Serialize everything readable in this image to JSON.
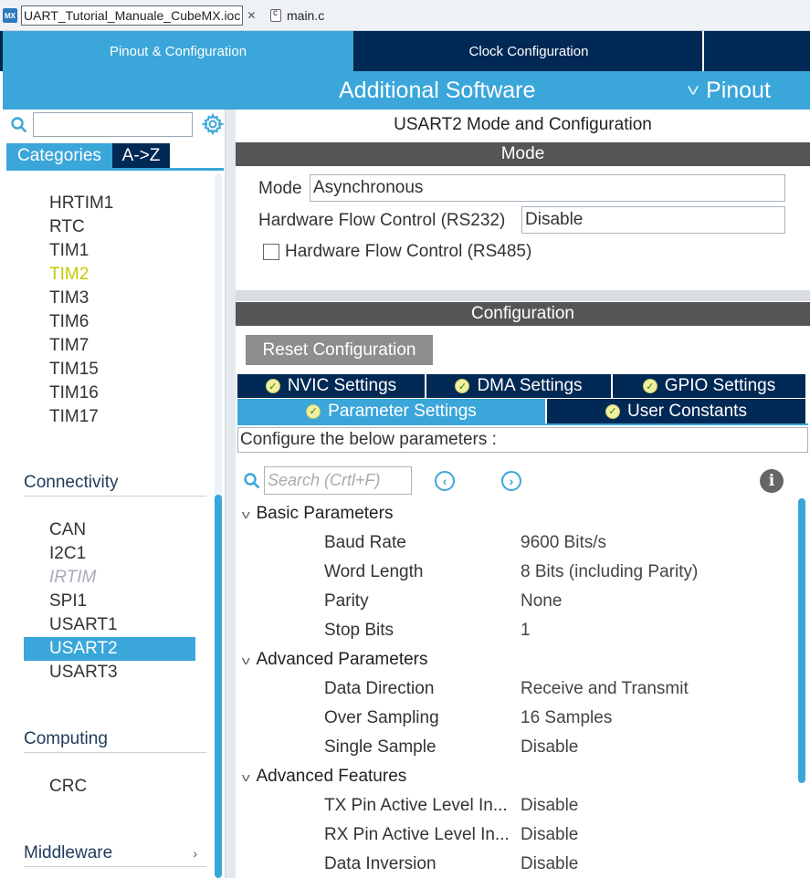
{
  "editor_tabs": [
    {
      "label": "UART_Tutorial_Manuale_CubeMX.ioc",
      "icon": "mx-icon",
      "active": true
    },
    {
      "label": "main.c",
      "icon": "c-file-icon",
      "active": false
    }
  ],
  "mx_badge": "MX",
  "topnav": {
    "pinout_config": "Pinout & Configuration",
    "clock_config": "Clock Configuration",
    "additional_software": "Additional Software",
    "pinout": "Pinout"
  },
  "left": {
    "search_placeholder": "",
    "categories_tab": "Categories",
    "az_tab": "A->Z",
    "timers_items": [
      "HRTIM1",
      "RTC",
      "TIM1",
      "TIM2",
      "TIM3",
      "TIM6",
      "TIM7",
      "TIM15",
      "TIM16",
      "TIM17"
    ],
    "connectivity_header": "Connectivity",
    "connectivity_items": [
      "CAN",
      "I2C1",
      "IRTIM",
      "SPI1",
      "USART1",
      "USART2",
      "USART3"
    ],
    "computing_header": "Computing",
    "computing_items": [
      "CRC"
    ],
    "middleware_header": "Middleware",
    "middleware_chevron": "›"
  },
  "right": {
    "title": "USART2 Mode and Configuration",
    "mode_header": "Mode",
    "mode_label": "Mode",
    "mode_value": "Asynchronous",
    "hwfc_label": "Hardware Flow Control (RS232)",
    "hwfc_value": "Disable",
    "rs485_label": "Hardware Flow Control (RS485)",
    "config_header": "Configuration",
    "reset_button": "Reset Configuration",
    "tabs": {
      "nvic": "NVIC Settings",
      "dma": "DMA Settings",
      "gpio": "GPIO Settings",
      "params": "Parameter Settings",
      "user_constants": "User Constants"
    },
    "configure_text": "Configure the below parameters :",
    "search_placeholder": "Search (Crtl+F)",
    "groups": {
      "basic": {
        "label": "Basic Parameters",
        "params": [
          {
            "name": "Baud Rate",
            "value": "9600 Bits/s"
          },
          {
            "name": "Word Length",
            "value": "8 Bits (including Parity)"
          },
          {
            "name": "Parity",
            "value": "None"
          },
          {
            "name": "Stop Bits",
            "value": "1"
          }
        ]
      },
      "advanced": {
        "label": "Advanced Parameters",
        "params": [
          {
            "name": "Data Direction",
            "value": "Receive and Transmit"
          },
          {
            "name": "Over Sampling",
            "value": "16 Samples"
          },
          {
            "name": "Single Sample",
            "value": "Disable"
          }
        ]
      },
      "features": {
        "label": "Advanced Features",
        "params": [
          {
            "name": "TX Pin Active Level In...",
            "value": "Disable"
          },
          {
            "name": "RX Pin Active Level In...",
            "value": "Disable"
          },
          {
            "name": "Data Inversion",
            "value": "Disable"
          }
        ]
      }
    }
  },
  "colors": {
    "accent": "#3aa6d9",
    "navy": "#002955",
    "header_bar": "#555555",
    "highlight_item": "#c9c900"
  }
}
